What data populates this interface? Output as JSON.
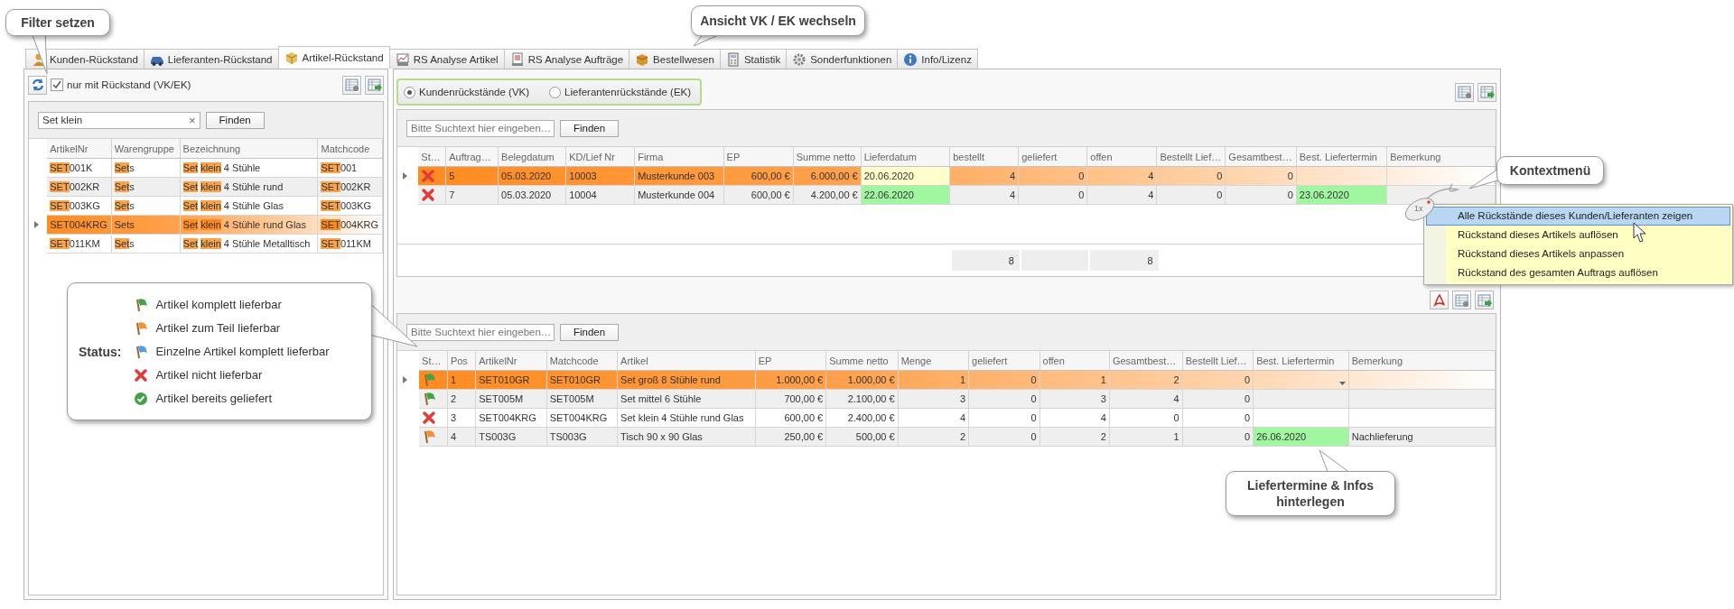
{
  "callouts": [
    {
      "text": "Filter setzen"
    },
    {
      "text": "Ansicht VK / EK wechseln"
    },
    {
      "text": "Kontextmenü"
    },
    {
      "text": "Liefertermine & Infos hinterlegen"
    }
  ],
  "tabs": [
    {
      "label": "Kunden-Rückstand",
      "selected": false
    },
    {
      "label": "Lieferanten-Rückstand",
      "selected": false
    },
    {
      "label": "Artikel-Rückstand",
      "selected": true
    },
    {
      "label": "RS Analyse Artikel",
      "selected": false
    },
    {
      "label": "RS Analyse Aufträge",
      "selected": false
    },
    {
      "label": "Bestellwesen",
      "selected": false
    },
    {
      "label": "Statistik",
      "selected": false
    },
    {
      "label": "Sonderfunktionen",
      "selected": false
    },
    {
      "label": "Info/Lizenz",
      "selected": false
    }
  ],
  "left_panel": {
    "filter": {
      "label": "nur mit Rückstand (VK/EK)",
      "checked": true
    },
    "search": {
      "value": "Set klein",
      "clear": "×",
      "button": "Finden"
    },
    "grid": {
      "columns": [
        "ArtikelNr",
        "Warengruppe",
        "Bezeichnung",
        "Matchcode"
      ],
      "rows": [
        {
          "selected": false,
          "cells": [
            [
              {
                "text": "SET",
                "match": true
              },
              {
                "text": "001K",
                "match": false
              }
            ],
            [
              {
                "text": "Set",
                "match": true
              },
              {
                "text": "s",
                "match": false
              }
            ],
            [
              {
                "text": "Set",
                "match": true
              },
              {
                "text": " ",
                "match": false
              },
              {
                "text": "klein",
                "match": true
              },
              {
                "text": " 4 Stühle",
                "match": false
              }
            ],
            [
              {
                "text": "SET",
                "match": true
              },
              {
                "text": "001",
                "match": false
              }
            ]
          ]
        },
        {
          "selected": false,
          "cells": [
            [
              {
                "text": "SET",
                "match": true
              },
              {
                "text": "002KR",
                "match": false
              }
            ],
            [
              {
                "text": "Set",
                "match": true
              },
              {
                "text": "s",
                "match": false
              }
            ],
            [
              {
                "text": "Set",
                "match": true
              },
              {
                "text": " ",
                "match": false
              },
              {
                "text": "klein",
                "match": true
              },
              {
                "text": " 4 Stühle rund",
                "match": false
              }
            ],
            [
              {
                "text": "SET",
                "match": true
              },
              {
                "text": "002KR",
                "match": false
              }
            ]
          ]
        },
        {
          "selected": false,
          "cells": [
            [
              {
                "text": "SET",
                "match": true
              },
              {
                "text": "003KG",
                "match": false
              }
            ],
            [
              {
                "text": "Set",
                "match": true
              },
              {
                "text": "s",
                "match": false
              }
            ],
            [
              {
                "text": "Set",
                "match": true
              },
              {
                "text": " ",
                "match": false
              },
              {
                "text": "klein",
                "match": true
              },
              {
                "text": " 4 Stühle Glas",
                "match": false
              }
            ],
            [
              {
                "text": "SET",
                "match": true
              },
              {
                "text": "003KG",
                "match": false
              }
            ]
          ]
        },
        {
          "selected": true,
          "cells": [
            [
              {
                "text": "SET004KRG",
                "match": false
              }
            ],
            [
              {
                "text": "Sets",
                "match": false
              }
            ],
            [
              {
                "text": "Set",
                "match": true
              },
              {
                "text": " ",
                "match": false
              },
              {
                "text": "klein",
                "match": true
              },
              {
                "text": " 4 Stühle rund Glas",
                "match": false
              }
            ],
            [
              {
                "text": "SET",
                "match": true
              },
              {
                "text": "004KRG",
                "match": false
              }
            ]
          ]
        },
        {
          "selected": false,
          "cells": [
            [
              {
                "text": "SET",
                "match": true
              },
              {
                "text": "011KM",
                "match": false
              }
            ],
            [
              {
                "text": "Set",
                "match": true
              },
              {
                "text": "s",
                "match": false
              }
            ],
            [
              {
                "text": "Set",
                "match": true
              },
              {
                "text": " ",
                "match": false
              },
              {
                "text": "klein",
                "match": true
              },
              {
                "text": " 4 Stühle Metalltisch",
                "match": false
              }
            ],
            [
              {
                "text": "SET",
                "match": true
              },
              {
                "text": "011KM",
                "match": false
              }
            ]
          ]
        }
      ]
    }
  },
  "right_panel": {
    "view": [
      {
        "label": "Kundenrückstände (VK)",
        "selected": true
      },
      {
        "label": "Lieferantenrückstände (EK)",
        "selected": false
      }
    ],
    "orders_grid": {
      "search": {
        "placeholder": "Bitte Suchtext hier eingeben…",
        "button": "Finden"
      },
      "columns": [
        "St…",
        "Auftrag…",
        "Belegdatum",
        "KD/Lief Nr",
        "Firma",
        "EP",
        "Summe netto",
        "Lieferdatum",
        "bestellt",
        "geliefert",
        "offen",
        "Bestellt Lief…",
        "Gesamtbest…",
        "Best. Liefertermin",
        "Bemerkung"
      ],
      "rows": [
        {
          "selected": true,
          "cells": [
            {
              "kind": "none"
            },
            "5",
            "05.03.2020",
            "10003",
            "Musterkunde 003",
            "600,00 €",
            "6.000,00 €",
            {
              "text": "20.06.2020",
              "color": "#ffffcc"
            },
            "4",
            "0",
            "4",
            "0",
            "0",
            "",
            ""
          ]
        },
        {
          "selected": false,
          "cells": [
            {
              "kind": "none"
            },
            "7",
            "05.03.2020",
            "10004",
            "Musterkunde 004",
            "600,00 €",
            "4.200,00 €",
            {
              "text": "22.06.2020",
              "color": "#a0f7a0"
            },
            "4",
            "0",
            "4",
            "0",
            "0",
            {
              "text": "23.06.2020",
              "color": "#a0f7a0"
            },
            ""
          ]
        }
      ],
      "totals": [
        {
          "kind": "sum",
          "text": "8"
        },
        {
          "kind": "empty"
        },
        {
          "kind": "sum",
          "text": "8"
        }
      ]
    },
    "items_grid": {
      "search": {
        "placeholder": "Bitte Suchtext hier eingeben…",
        "button": "Finden"
      },
      "columns": [
        "St…",
        "Pos",
        "ArtikelNr",
        "Matchcode",
        "Artikel",
        "EP",
        "Summe netto",
        "Menge",
        "geliefert",
        "offen",
        "Gesamtbest…",
        "Bestellt Lief…",
        "Best. Liefertermin",
        "Bemerkung"
      ],
      "rows": [
        {
          "selected": true,
          "cells": [
            {
              "kind": "complete"
            },
            "1",
            "SET010GR",
            "SET010GR",
            "Set groß 8 Stühle rund",
            "1.000,00 €",
            "1.000,00 €",
            "1",
            "0",
            "1",
            "2",
            "0",
            {
              "kind": "dropdown"
            },
            ""
          ]
        },
        {
          "selected": false,
          "cells": [
            {
              "kind": "complete"
            },
            "2",
            "SET005M",
            "SET005M",
            "Set mittel 6 Stühle",
            "700,00 €",
            "2.100,00 €",
            "3",
            "0",
            "3",
            "4",
            "0",
            "",
            ""
          ]
        },
        {
          "selected": false,
          "cells": [
            {
              "kind": "none"
            },
            "3",
            "SET004KRG",
            "SET004KRG",
            "Set klein 4 Stühle rund Glas",
            "600,00 €",
            "2.400,00 €",
            "4",
            "0",
            "4",
            "0",
            "0",
            "",
            ""
          ]
        },
        {
          "selected": false,
          "cells": [
            {
              "kind": "partial"
            },
            "4",
            "TS003G",
            "TS003G",
            "Tisch 90 x 90 Glas",
            "250,00 €",
            "500,00 €",
            "2",
            "0",
            "2",
            "1",
            "0",
            {
              "text": "26.06.2020",
              "color": "#a0f7a0"
            },
            "Nachlieferung"
          ]
        }
      ]
    }
  },
  "context_menu": {
    "click_label": "1x",
    "items": [
      {
        "label": "Alle Rückstände dieses Kunden/Lieferanten zeigen",
        "selected": true
      },
      {
        "label": "Rückstand dieses Artikels auflösen",
        "selected": false
      },
      {
        "label": "Rückstand dieses Artikels anpassen",
        "selected": false
      },
      {
        "label": "Rückstand des gesamten Auftrags auflösen",
        "selected": false
      }
    ]
  },
  "legend": {
    "label": "Status:",
    "items": [
      {
        "kind": "complete",
        "text": "Artikel komplett lieferbar"
      },
      {
        "kind": "partial",
        "text": "Artikel zum Teil lieferbar"
      },
      {
        "kind": "some",
        "text": "Einzelne Artikel komplett lieferbar"
      },
      {
        "kind": "none",
        "text": "Artikel nicht lieferbar"
      },
      {
        "kind": "delivered",
        "text": "Artikel bereits geliefert"
      }
    ]
  }
}
